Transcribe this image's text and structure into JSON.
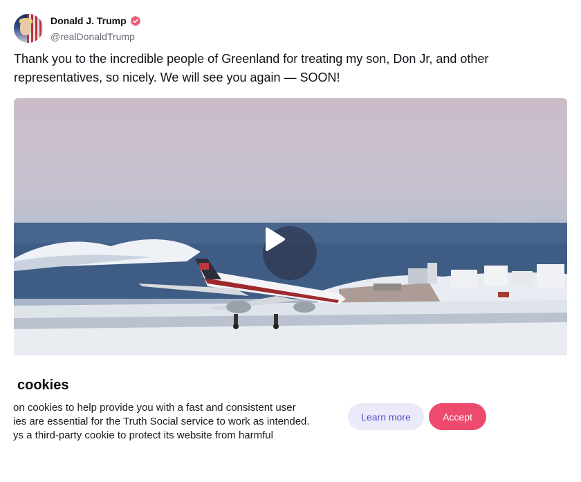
{
  "post": {
    "author_name": "Donald J. Trump",
    "author_handle": "@realDonaldTrump",
    "verified_icon": "verified-badge-icon",
    "text": "Thank you to the incredible people of Greenland for treating my son, Don Jr, and other representatives, so nicely. We will see you again — SOON!",
    "media": {
      "type": "video",
      "play_icon": "play-icon"
    }
  },
  "cookie_banner": {
    "title": "cookies",
    "lines": [
      "on cookies to help provide you with a fast and consistent user",
      "ies are essential for the Truth Social service to work as intended.",
      "ys a third-party cookie to protect its website from harmful"
    ],
    "learn_more_label": "Learn more",
    "accept_label": "Accept"
  },
  "colors": {
    "accent": "#ee4a6d",
    "secondary_button_bg": "#ebeaf8",
    "secondary_button_text": "#5a4fd0",
    "verified": "#e95a76"
  }
}
